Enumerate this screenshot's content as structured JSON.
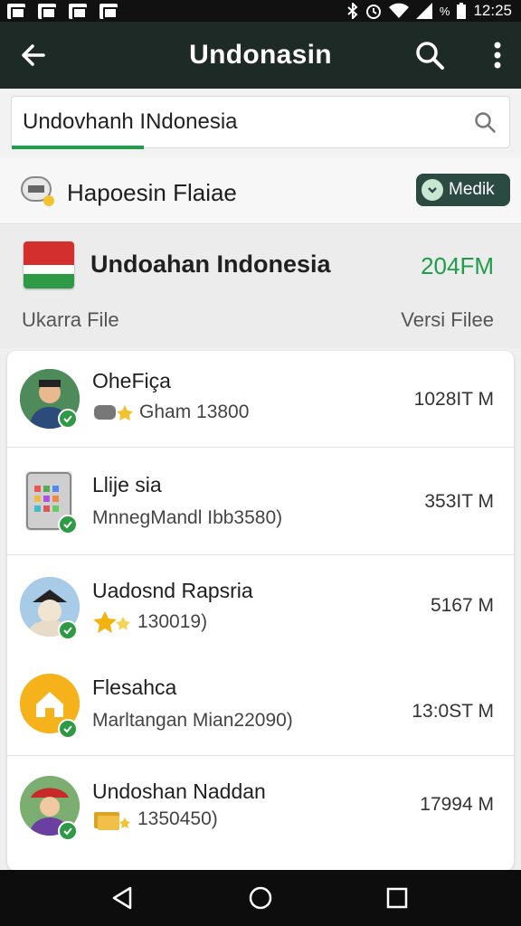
{
  "status_bar": {
    "time": "12:25",
    "battery_text": "%",
    "left_icons": [
      "gallery-icon",
      "shield-icon",
      "image-icon",
      "runner-icon"
    ],
    "right_icons": [
      "bluetooth-icon",
      "alarm-icon",
      "wifi-icon",
      "signal-icon",
      "battery-icon"
    ]
  },
  "app_bar": {
    "title": "Undonasin",
    "back_icon": "arrow-left-icon",
    "search_icon": "search-icon",
    "menu_icon": "more-vert-icon"
  },
  "search": {
    "value": "Undovhanh INdonesia",
    "icon": "search-icon"
  },
  "filter": {
    "label": "Hapoesin Flaiae",
    "button_label": "Medik",
    "accent": "#2b4a41"
  },
  "featured": {
    "title": "Undoahan Indonesia",
    "size": "204FM",
    "col_left": "Ukarra File",
    "col_right": "Versi Filee"
  },
  "files": [
    {
      "name": "OheFiça",
      "sub": "Gham 13800",
      "size": "1028IT M",
      "avatar": "man-avatar",
      "sub_icon": "cat-star-icon"
    },
    {
      "name": "Llije sia",
      "sub": "MnnegMandl Ibb3580)",
      "size": "353IT M",
      "avatar": "tablet-avatar",
      "sub_icon": ""
    },
    {
      "name": "Uadosnd Rapsria",
      "sub": "130019)",
      "size": "5167 M",
      "avatar": "hat-avatar",
      "sub_icon": "stars-icon"
    },
    {
      "name": "Flesahca",
      "sub": "Marltangan Mian22090)",
      "size": "13:0ST M",
      "avatar": "home-avatar",
      "sub_icon": ""
    },
    {
      "name": "Undoshan Naddan",
      "sub": "1350450)",
      "size": "17994 M",
      "avatar": "woman-avatar",
      "sub_icon": "folder-star-icon"
    }
  ],
  "nav": {
    "back": "nav-back-icon",
    "home": "nav-home-icon",
    "recents": "nav-recents-icon"
  }
}
